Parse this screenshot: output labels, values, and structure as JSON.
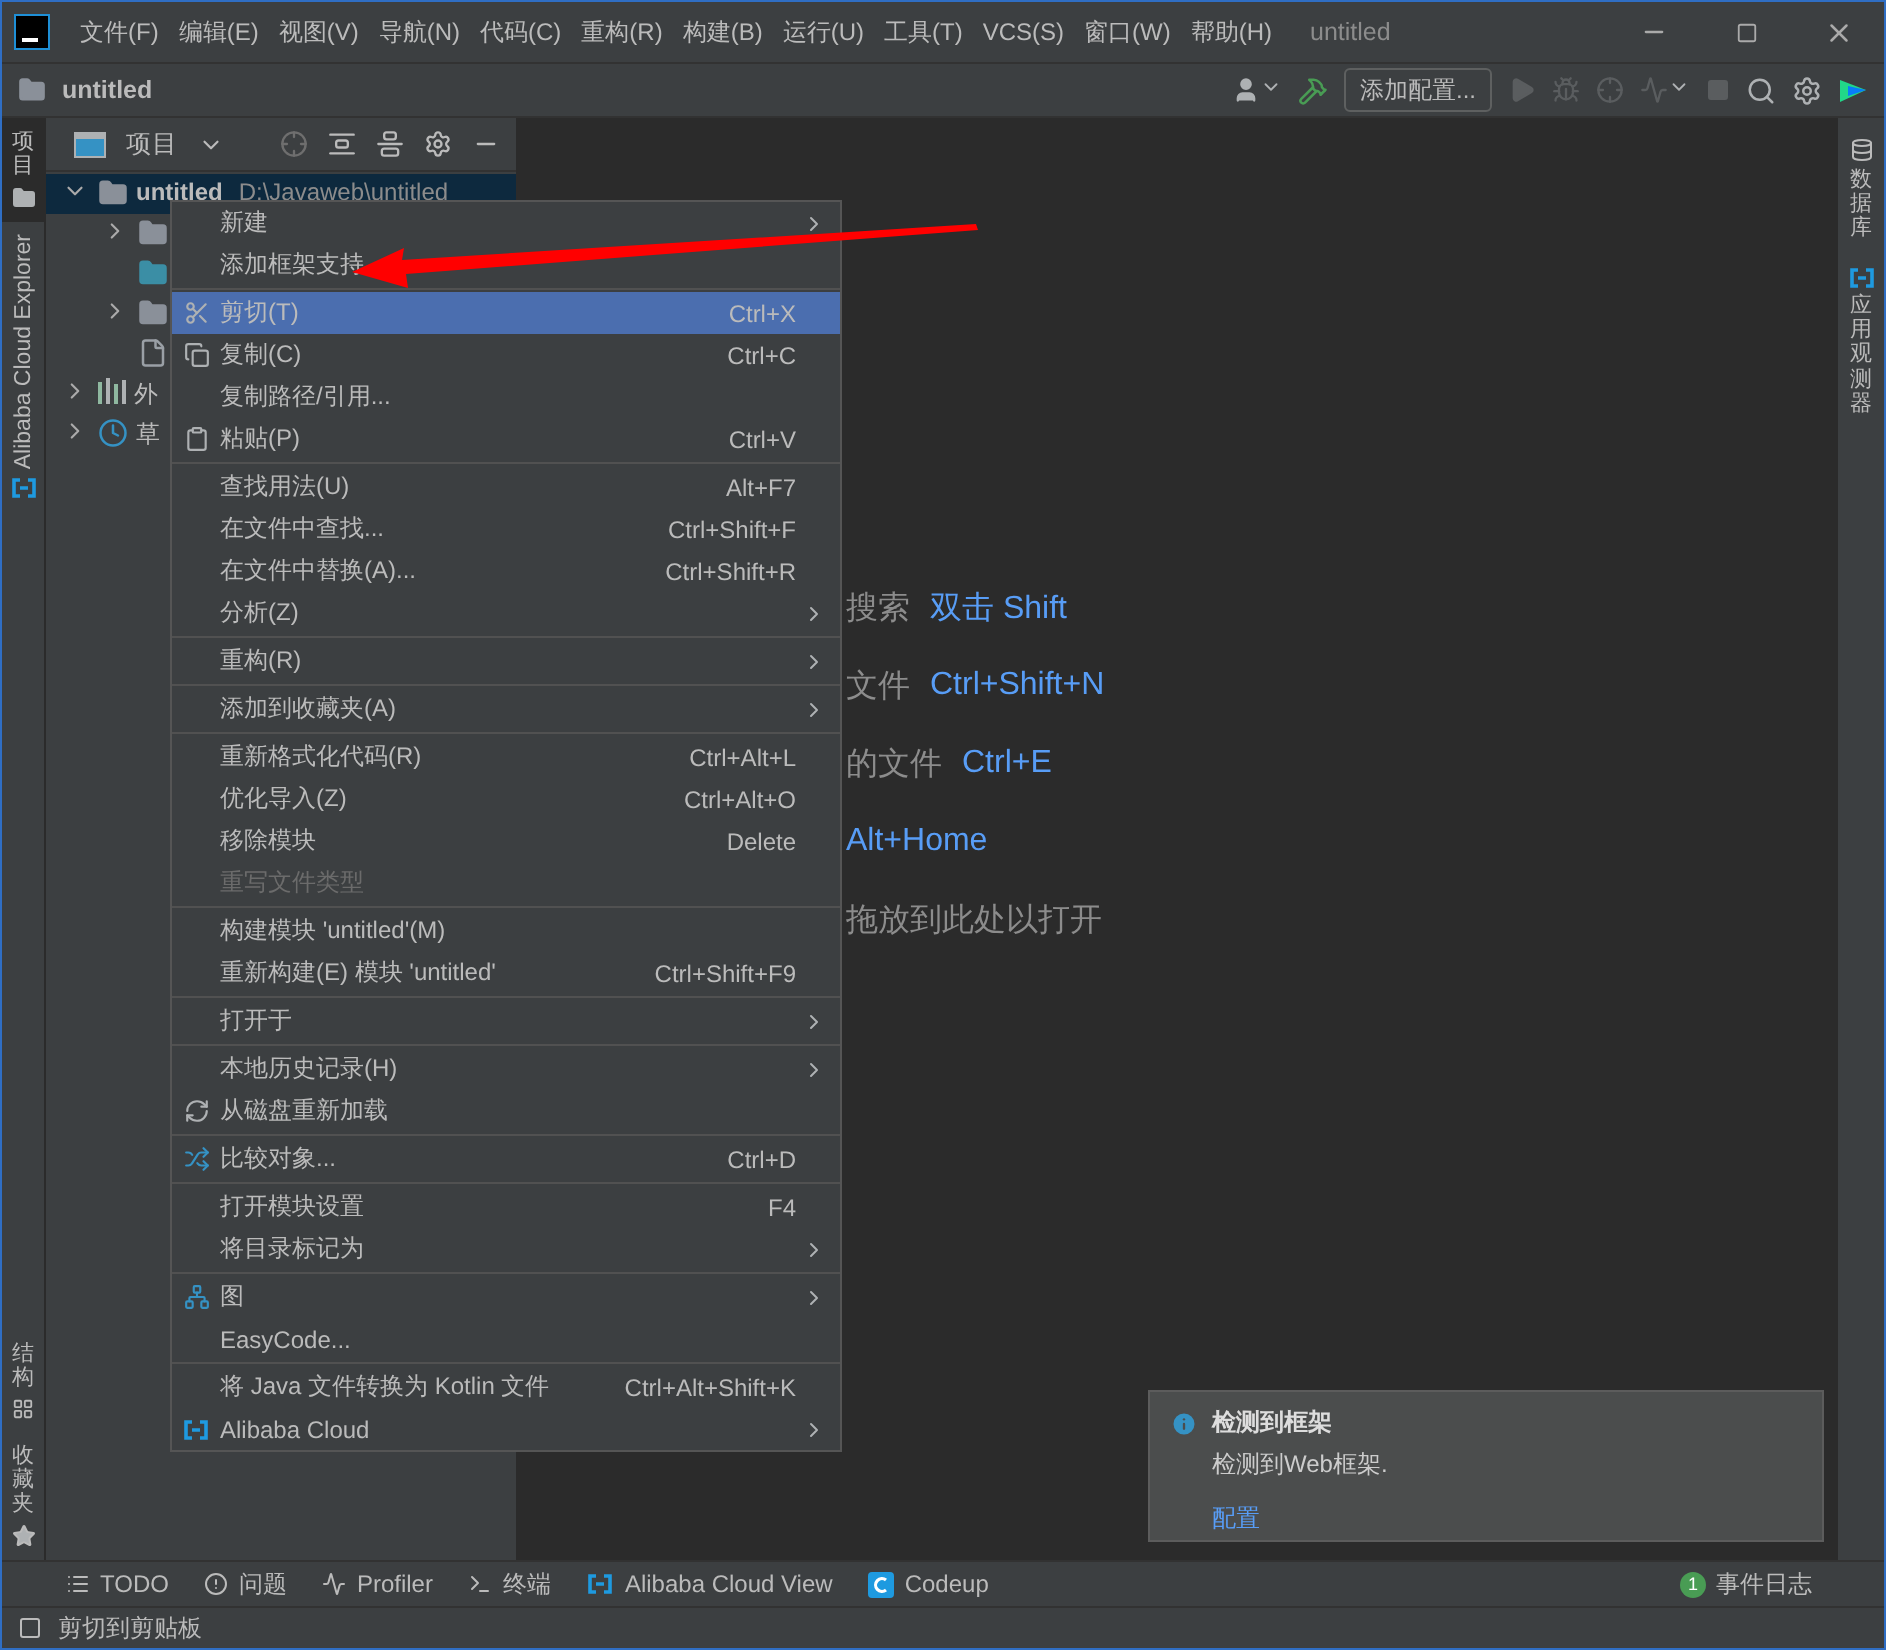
{
  "title_bar": {
    "menus": [
      "文件(F)",
      "编辑(E)",
      "视图(V)",
      "导航(N)",
      "代码(C)",
      "重构(R)",
      "构建(B)",
      "运行(U)",
      "工具(T)",
      "VCS(S)",
      "窗口(W)",
      "帮助(H)"
    ],
    "title": "untitled"
  },
  "nav_bar": {
    "project": "untitled",
    "run_config": "添加配置..."
  },
  "left_stripe": [
    {
      "label": "项目",
      "selected": true
    },
    {
      "label": "Alibaba Cloud Explorer",
      "selected": false
    }
  ],
  "left_stripe_bottom": [
    "结构",
    "收藏夹"
  ],
  "project_panel": {
    "title": "项目",
    "tree": [
      {
        "kind": "module",
        "label": "untitled",
        "path": "D:\\Javaweb\\untitled",
        "expanded": true,
        "selected": true,
        "children": [
          {
            "kind": "folder",
            "expanded": false,
            "selected": false
          },
          {
            "kind": "source_folder",
            "selected": false
          },
          {
            "kind": "folder",
            "expanded": false,
            "selected": false
          },
          {
            "kind": "file",
            "selected": false
          }
        ]
      },
      {
        "kind": "libraries",
        "label": "外",
        "expanded": false,
        "selected": false
      },
      {
        "kind": "scratches",
        "label": "草",
        "expanded": false,
        "selected": false
      }
    ]
  },
  "context_menu": {
    "items": [
      {
        "kind": "plain",
        "label": "新建",
        "submenu": true,
        "selected": false,
        "disabled": false
      },
      {
        "kind": "plain",
        "label": "添加框架支持",
        "submenu": false,
        "selected": false,
        "disabled": false
      },
      {
        "kind": "separator"
      },
      {
        "kind": "cut",
        "label": "剪切(T)",
        "shortcut": "Ctrl+X",
        "submenu": false,
        "selected": true,
        "disabled": false
      },
      {
        "kind": "copy",
        "label": "复制(C)",
        "shortcut": "Ctrl+C",
        "submenu": false,
        "selected": false,
        "disabled": false
      },
      {
        "kind": "plain",
        "label": "复制路径/引用...",
        "submenu": false,
        "selected": false,
        "disabled": false
      },
      {
        "kind": "paste",
        "label": "粘贴(P)",
        "shortcut": "Ctrl+V",
        "submenu": false,
        "selected": false,
        "disabled": false
      },
      {
        "kind": "separator"
      },
      {
        "kind": "plain",
        "label": "查找用法(U)",
        "shortcut": "Alt+F7",
        "submenu": false,
        "selected": false,
        "disabled": false
      },
      {
        "kind": "plain",
        "label": "在文件中查找...",
        "shortcut": "Ctrl+Shift+F",
        "submenu": false,
        "selected": false,
        "disabled": false
      },
      {
        "kind": "plain",
        "label": "在文件中替换(A)...",
        "shortcut": "Ctrl+Shift+R",
        "submenu": false,
        "selected": false,
        "disabled": false
      },
      {
        "kind": "plain",
        "label": "分析(Z)",
        "submenu": true,
        "selected": false,
        "disabled": false
      },
      {
        "kind": "separator"
      },
      {
        "kind": "plain",
        "label": "重构(R)",
        "submenu": true,
        "selected": false,
        "disabled": false
      },
      {
        "kind": "separator"
      },
      {
        "kind": "plain",
        "label": "添加到收藏夹(A)",
        "submenu": true,
        "selected": false,
        "disabled": false
      },
      {
        "kind": "separator"
      },
      {
        "kind": "plain",
        "label": "重新格式化代码(R)",
        "shortcut": "Ctrl+Alt+L",
        "submenu": false,
        "selected": false,
        "disabled": false
      },
      {
        "kind": "plain",
        "label": "优化导入(Z)",
        "shortcut": "Ctrl+Alt+O",
        "submenu": false,
        "selected": false,
        "disabled": false
      },
      {
        "kind": "plain",
        "label": "移除模块",
        "shortcut": "Delete",
        "submenu": false,
        "selected": false,
        "disabled": false
      },
      {
        "kind": "plain",
        "label": "重写文件类型",
        "submenu": false,
        "selected": false,
        "disabled": true
      },
      {
        "kind": "separator"
      },
      {
        "kind": "plain",
        "label": "构建模块 'untitled'(M)",
        "submenu": false,
        "selected": false,
        "disabled": false
      },
      {
        "kind": "plain",
        "label": "重新构建(E) 模块 'untitled'",
        "shortcut": "Ctrl+Shift+F9",
        "submenu": false,
        "selected": false,
        "disabled": false
      },
      {
        "kind": "separator"
      },
      {
        "kind": "plain",
        "label": "打开于",
        "submenu": true,
        "selected": false,
        "disabled": false
      },
      {
        "kind": "separator"
      },
      {
        "kind": "plain",
        "label": "本地历史记录(H)",
        "submenu": true,
        "selected": false,
        "disabled": false
      },
      {
        "kind": "reload",
        "label": "从磁盘重新加载",
        "submenu": false,
        "selected": false,
        "disabled": false
      },
      {
        "kind": "separator"
      },
      {
        "kind": "compare",
        "label": "比较对象...",
        "shortcut": "Ctrl+D",
        "submenu": false,
        "selected": false,
        "disabled": false
      },
      {
        "kind": "separator"
      },
      {
        "kind": "plain",
        "label": "打开模块设置",
        "shortcut": "F4",
        "submenu": false,
        "selected": false,
        "disabled": false
      },
      {
        "kind": "plain",
        "label": "将目录标记为",
        "submenu": true,
        "selected": false,
        "disabled": false
      },
      {
        "kind": "separator"
      },
      {
        "kind": "diagram",
        "label": "图",
        "submenu": true,
        "selected": false,
        "disabled": false
      },
      {
        "kind": "plain",
        "label": "EasyCode...",
        "submenu": false,
        "selected": false,
        "disabled": false
      },
      {
        "kind": "separator"
      },
      {
        "kind": "plain",
        "label": "将 Java 文件转换为 Kotlin 文件",
        "shortcut": "Ctrl+Alt+Shift+K",
        "submenu": false,
        "selected": false,
        "disabled": false
      },
      {
        "kind": "cloud",
        "label": "Alibaba Cloud",
        "submenu": true,
        "selected": false,
        "disabled": false
      }
    ]
  },
  "editor_hints": [
    {
      "label": "搜索",
      "shortcut": "双击 Shift"
    },
    {
      "label": "文件",
      "shortcut": "Ctrl+Shift+N"
    },
    {
      "label": "的文件",
      "shortcut": "Ctrl+E"
    },
    {
      "shortcut": "Alt+Home"
    },
    {
      "label": "拖放到此处以打开"
    }
  ],
  "right_stripe": [
    "数据库",
    "应用观测器"
  ],
  "notification": {
    "title": "检测到框架",
    "body": "检测到Web框架.",
    "link": "配置"
  },
  "tool_windows": [
    {
      "kind": "todo",
      "label": "TODO"
    },
    {
      "kind": "problems",
      "label": "问题"
    },
    {
      "kind": "profiler",
      "label": "Profiler"
    },
    {
      "kind": "terminal",
      "label": "终端"
    },
    {
      "kind": "cloud",
      "label": "Alibaba Cloud View"
    },
    {
      "kind": "codeup",
      "label": "Codeup"
    }
  ],
  "event_log": {
    "count": "1",
    "label": "事件日志"
  },
  "status_bar": {
    "message": "剪切到剪贴板"
  }
}
